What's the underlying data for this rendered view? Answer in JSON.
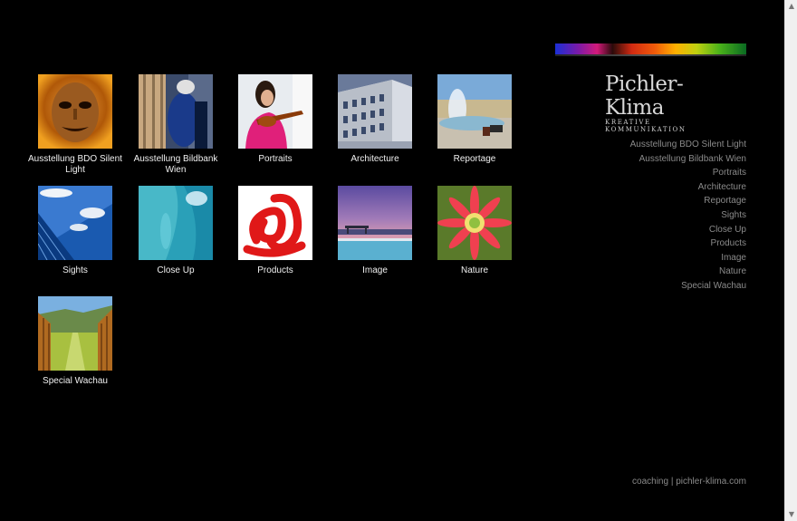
{
  "brand": {
    "title": "Pichler-Klima",
    "subtitle": "KREATIVE KOMMUNIKATION"
  },
  "gallery": [
    {
      "label": "Ausstellung BDO Silent Light",
      "icon": "mask-photo-icon"
    },
    {
      "label": "Ausstellung Bildbank Wien",
      "icon": "people-photo-icon"
    },
    {
      "label": "Portraits",
      "icon": "violinist-photo-icon"
    },
    {
      "label": "Architecture",
      "icon": "building-photo-icon"
    },
    {
      "label": "Reportage",
      "icon": "fountain-photo-icon"
    },
    {
      "label": "Sights",
      "icon": "sky-photo-icon"
    },
    {
      "label": "Close Up",
      "icon": "water-photo-icon"
    },
    {
      "label": "Products",
      "icon": "red-ribbon-photo-icon"
    },
    {
      "label": "Image",
      "icon": "pool-photo-icon"
    },
    {
      "label": "Nature",
      "icon": "flower-photo-icon"
    },
    {
      "label": "Special Wachau",
      "icon": "vineyard-photo-icon"
    }
  ],
  "nav": [
    "Ausstellung BDO Silent Light",
    "Ausstellung Bildbank Wien",
    "Portraits",
    "Architecture",
    "Reportage",
    "Sights",
    "Close Up",
    "Products",
    "Image",
    "Nature",
    "Special Wachau"
  ],
  "footer": "coaching | pichler-klima.com",
  "colors": {
    "background": "#000000",
    "nav_text": "#8a8a8a",
    "caption_text": "#f0f0f0"
  }
}
